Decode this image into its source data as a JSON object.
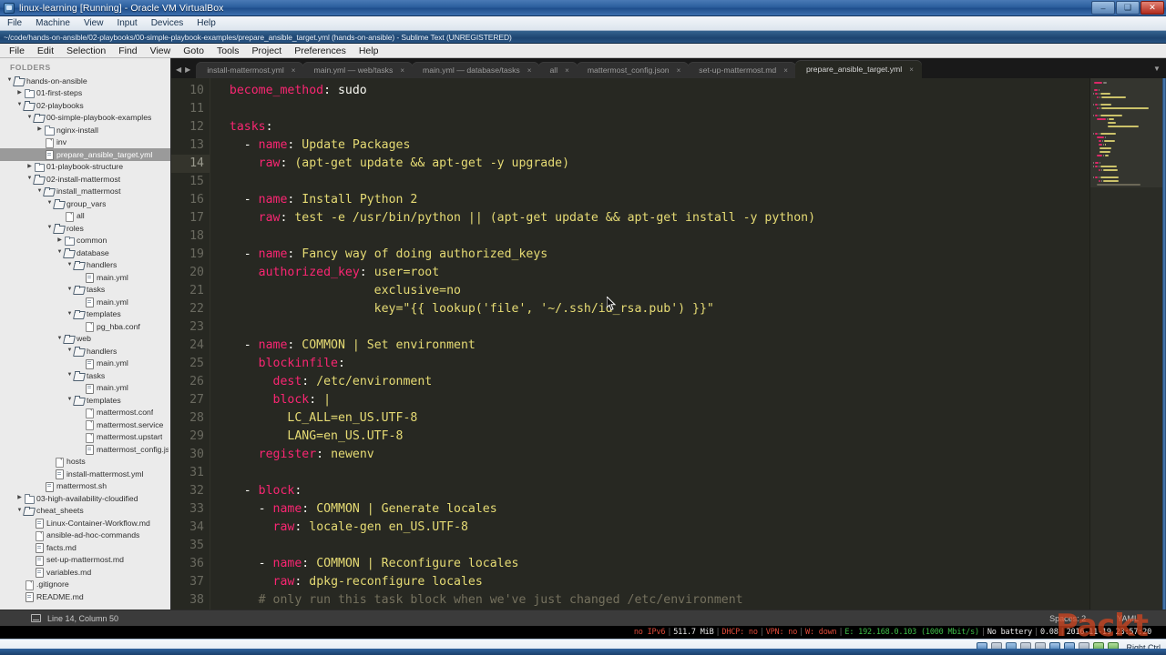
{
  "vbox": {
    "title": "linux-learning [Running] - Oracle VM VirtualBox",
    "menu": [
      "File",
      "Machine",
      "View",
      "Input",
      "Devices",
      "Help"
    ],
    "window_buttons": {
      "minimize": "–",
      "maximize": "❑",
      "close": "✕"
    },
    "host_key_label": "Right Ctrl"
  },
  "sublime": {
    "title": "~/code/hands-on-ansible/02-playbooks/00-simple-playbook-examples/prepare_ansible_target.yml (hands-on-ansible) - Sublime Text (UNREGISTERED)",
    "menu": [
      "File",
      "Edit",
      "Selection",
      "Find",
      "View",
      "Goto",
      "Tools",
      "Project",
      "Preferences",
      "Help"
    ],
    "sidebar": {
      "header": "FOLDERS",
      "items": [
        {
          "label": "hands-on-ansible",
          "depth": 0,
          "arrow": "down",
          "icon": "folder-open-icon",
          "selected": false
        },
        {
          "label": "01-first-steps",
          "depth": 1,
          "arrow": "right",
          "icon": "folder-icon",
          "selected": false
        },
        {
          "label": "02-playbooks",
          "depth": 1,
          "arrow": "down",
          "icon": "folder-open-icon",
          "selected": false
        },
        {
          "label": "00-simple-playbook-examples",
          "depth": 2,
          "arrow": "down",
          "icon": "folder-open-icon",
          "selected": false
        },
        {
          "label": "nginx-install",
          "depth": 3,
          "arrow": "right",
          "icon": "folder-icon",
          "selected": false
        },
        {
          "label": "inv",
          "depth": 3,
          "arrow": "none",
          "icon": "file-icon",
          "selected": false
        },
        {
          "label": "prepare_ansible_target.yml",
          "depth": 3,
          "arrow": "none",
          "icon": "code-file-icon",
          "selected": true
        },
        {
          "label": "01-playbook-structure",
          "depth": 2,
          "arrow": "right",
          "icon": "folder-icon",
          "selected": false
        },
        {
          "label": "02-install-mattermost",
          "depth": 2,
          "arrow": "down",
          "icon": "folder-open-icon",
          "selected": false
        },
        {
          "label": "install_mattermost",
          "depth": 3,
          "arrow": "down",
          "icon": "folder-open-icon",
          "selected": false
        },
        {
          "label": "group_vars",
          "depth": 4,
          "arrow": "down",
          "icon": "folder-open-icon",
          "selected": false
        },
        {
          "label": "all",
          "depth": 5,
          "arrow": "none",
          "icon": "file-icon",
          "selected": false
        },
        {
          "label": "roles",
          "depth": 4,
          "arrow": "down",
          "icon": "folder-open-icon",
          "selected": false
        },
        {
          "label": "common",
          "depth": 5,
          "arrow": "right",
          "icon": "folder-icon",
          "selected": false
        },
        {
          "label": "database",
          "depth": 5,
          "arrow": "down",
          "icon": "folder-open-icon",
          "selected": false
        },
        {
          "label": "handlers",
          "depth": 6,
          "arrow": "down",
          "icon": "folder-open-icon",
          "selected": false
        },
        {
          "label": "main.yml",
          "depth": 7,
          "arrow": "none",
          "icon": "code-file-icon",
          "selected": false
        },
        {
          "label": "tasks",
          "depth": 6,
          "arrow": "down",
          "icon": "folder-open-icon",
          "selected": false
        },
        {
          "label": "main.yml",
          "depth": 7,
          "arrow": "none",
          "icon": "code-file-icon",
          "selected": false
        },
        {
          "label": "templates",
          "depth": 6,
          "arrow": "down",
          "icon": "folder-open-icon",
          "selected": false
        },
        {
          "label": "pg_hba.conf",
          "depth": 7,
          "arrow": "none",
          "icon": "file-icon",
          "selected": false
        },
        {
          "label": "web",
          "depth": 5,
          "arrow": "down",
          "icon": "folder-open-icon",
          "selected": false
        },
        {
          "label": "handlers",
          "depth": 6,
          "arrow": "down",
          "icon": "folder-open-icon",
          "selected": false
        },
        {
          "label": "main.yml",
          "depth": 7,
          "arrow": "none",
          "icon": "code-file-icon",
          "selected": false
        },
        {
          "label": "tasks",
          "depth": 6,
          "arrow": "down",
          "icon": "folder-open-icon",
          "selected": false
        },
        {
          "label": "main.yml",
          "depth": 7,
          "arrow": "none",
          "icon": "code-file-icon",
          "selected": false
        },
        {
          "label": "templates",
          "depth": 6,
          "arrow": "down",
          "icon": "folder-open-icon",
          "selected": false
        },
        {
          "label": "mattermost.conf",
          "depth": 7,
          "arrow": "none",
          "icon": "file-icon",
          "selected": false
        },
        {
          "label": "mattermost.service",
          "depth": 7,
          "arrow": "none",
          "icon": "file-icon",
          "selected": false
        },
        {
          "label": "mattermost.upstart",
          "depth": 7,
          "arrow": "none",
          "icon": "file-icon",
          "selected": false
        },
        {
          "label": "mattermost_config.json",
          "depth": 7,
          "arrow": "none",
          "icon": "code-file-icon",
          "selected": false
        },
        {
          "label": "hosts",
          "depth": 4,
          "arrow": "none",
          "icon": "file-icon",
          "selected": false
        },
        {
          "label": "install-mattermost.yml",
          "depth": 4,
          "arrow": "none",
          "icon": "code-file-icon",
          "selected": false
        },
        {
          "label": "mattermost.sh",
          "depth": 3,
          "arrow": "none",
          "icon": "code-file-icon",
          "selected": false
        },
        {
          "label": "03-high-availability-cloudified",
          "depth": 1,
          "arrow": "right",
          "icon": "folder-icon",
          "selected": false
        },
        {
          "label": "cheat_sheets",
          "depth": 1,
          "arrow": "down",
          "icon": "folder-open-icon",
          "selected": false
        },
        {
          "label": "Linux-Container-Workflow.md",
          "depth": 2,
          "arrow": "none",
          "icon": "code-file-icon",
          "selected": false
        },
        {
          "label": "ansible-ad-hoc-commands",
          "depth": 2,
          "arrow": "none",
          "icon": "file-icon",
          "selected": false
        },
        {
          "label": "facts.md",
          "depth": 2,
          "arrow": "none",
          "icon": "code-file-icon",
          "selected": false
        },
        {
          "label": "set-up-mattermost.md",
          "depth": 2,
          "arrow": "none",
          "icon": "code-file-icon",
          "selected": false
        },
        {
          "label": "variables.md",
          "depth": 2,
          "arrow": "none",
          "icon": "code-file-icon",
          "selected": false
        },
        {
          "label": ".gitignore",
          "depth": 1,
          "arrow": "none",
          "icon": "file-icon",
          "selected": false
        },
        {
          "label": "README.md",
          "depth": 1,
          "arrow": "none",
          "icon": "code-file-icon",
          "selected": false
        }
      ]
    },
    "tabbar": {
      "prev_icon": "◀",
      "next_icon": "▶",
      "overflow_icon": "▼",
      "close_icon": "×",
      "tabs": [
        {
          "label": "install-mattermost.yml",
          "active": false
        },
        {
          "label": "main.yml — web/tasks",
          "active": false
        },
        {
          "label": "main.yml — database/tasks",
          "active": false
        },
        {
          "label": "all",
          "active": false
        },
        {
          "label": "mattermost_config.json",
          "active": false
        },
        {
          "label": "set-up-mattermost.md",
          "active": false
        },
        {
          "label": "prepare_ansible_target.yml",
          "active": true
        }
      ]
    },
    "editor": {
      "first_line": 10,
      "highlight_line": 14,
      "lines": [
        {
          "n": 10,
          "tokens": [
            {
              "t": "  ",
              "c": "p"
            },
            {
              "t": "become_method",
              "c": "k"
            },
            {
              "t": ": sudo",
              "c": "p"
            }
          ]
        },
        {
          "n": 11,
          "tokens": []
        },
        {
          "n": 12,
          "tokens": [
            {
              "t": "  ",
              "c": "p"
            },
            {
              "t": "tasks",
              "c": "k"
            },
            {
              "t": ":",
              "c": "p"
            }
          ]
        },
        {
          "n": 13,
          "tokens": [
            {
              "t": "    - ",
              "c": "p"
            },
            {
              "t": "name",
              "c": "k"
            },
            {
              "t": ": ",
              "c": "p"
            },
            {
              "t": "Update Packages",
              "c": "v"
            }
          ]
        },
        {
          "n": 14,
          "tokens": [
            {
              "t": "      ",
              "c": "p"
            },
            {
              "t": "raw",
              "c": "k"
            },
            {
              "t": ": ",
              "c": "p"
            },
            {
              "t": "(apt-get update && apt-get -y upgrade)",
              "c": "v"
            }
          ]
        },
        {
          "n": 15,
          "tokens": []
        },
        {
          "n": 16,
          "tokens": [
            {
              "t": "    - ",
              "c": "p"
            },
            {
              "t": "name",
              "c": "k"
            },
            {
              "t": ": ",
              "c": "p"
            },
            {
              "t": "Install Python 2",
              "c": "v"
            }
          ]
        },
        {
          "n": 17,
          "tokens": [
            {
              "t": "      ",
              "c": "p"
            },
            {
              "t": "raw",
              "c": "k"
            },
            {
              "t": ": ",
              "c": "p"
            },
            {
              "t": "test -e /usr/bin/python || (apt-get update && apt-get install -y python)",
              "c": "v"
            }
          ]
        },
        {
          "n": 18,
          "tokens": []
        },
        {
          "n": 19,
          "tokens": [
            {
              "t": "    - ",
              "c": "p"
            },
            {
              "t": "name",
              "c": "k"
            },
            {
              "t": ": ",
              "c": "p"
            },
            {
              "t": "Fancy way of doing authorized_keys",
              "c": "v"
            }
          ]
        },
        {
          "n": 20,
          "tokens": [
            {
              "t": "      ",
              "c": "p"
            },
            {
              "t": "authorized_key",
              "c": "k"
            },
            {
              "t": ": ",
              "c": "p"
            },
            {
              "t": "user=root",
              "c": "v"
            }
          ]
        },
        {
          "n": 21,
          "tokens": [
            {
              "t": "                      ",
              "c": "p"
            },
            {
              "t": "exclusive=no",
              "c": "v"
            }
          ]
        },
        {
          "n": 22,
          "tokens": [
            {
              "t": "                      ",
              "c": "p"
            },
            {
              "t": "key=\"{{ lookup('file', '~/.ssh/id_rsa.pub') }}\"",
              "c": "v"
            }
          ]
        },
        {
          "n": 23,
          "tokens": []
        },
        {
          "n": 24,
          "tokens": [
            {
              "t": "    - ",
              "c": "p"
            },
            {
              "t": "name",
              "c": "k"
            },
            {
              "t": ": ",
              "c": "p"
            },
            {
              "t": "COMMON | Set environment",
              "c": "v"
            }
          ]
        },
        {
          "n": 25,
          "tokens": [
            {
              "t": "      ",
              "c": "p"
            },
            {
              "t": "blockinfile",
              "c": "k"
            },
            {
              "t": ":",
              "c": "p"
            }
          ]
        },
        {
          "n": 26,
          "tokens": [
            {
              "t": "        ",
              "c": "p"
            },
            {
              "t": "dest",
              "c": "k"
            },
            {
              "t": ": ",
              "c": "p"
            },
            {
              "t": "/etc/environment",
              "c": "v"
            }
          ]
        },
        {
          "n": 27,
          "tokens": [
            {
              "t": "        ",
              "c": "p"
            },
            {
              "t": "block",
              "c": "k"
            },
            {
              "t": ": ",
              "c": "p"
            },
            {
              "t": "|",
              "c": "v"
            }
          ]
        },
        {
          "n": 28,
          "tokens": [
            {
              "t": "          ",
              "c": "p"
            },
            {
              "t": "LC_ALL=en_US.UTF-8",
              "c": "v"
            }
          ]
        },
        {
          "n": 29,
          "tokens": [
            {
              "t": "          ",
              "c": "p"
            },
            {
              "t": "LANG=en_US.UTF-8",
              "c": "v"
            }
          ]
        },
        {
          "n": 30,
          "tokens": [
            {
              "t": "      ",
              "c": "p"
            },
            {
              "t": "register",
              "c": "k"
            },
            {
              "t": ": ",
              "c": "p"
            },
            {
              "t": "newenv",
              "c": "v"
            }
          ]
        },
        {
          "n": 31,
          "tokens": []
        },
        {
          "n": 32,
          "tokens": [
            {
              "t": "    - ",
              "c": "p"
            },
            {
              "t": "block",
              "c": "k"
            },
            {
              "t": ":",
              "c": "p"
            }
          ]
        },
        {
          "n": 33,
          "tokens": [
            {
              "t": "      - ",
              "c": "p"
            },
            {
              "t": "name",
              "c": "k"
            },
            {
              "t": ": ",
              "c": "p"
            },
            {
              "t": "COMMON | Generate locales",
              "c": "v"
            }
          ]
        },
        {
          "n": 34,
          "tokens": [
            {
              "t": "        ",
              "c": "p"
            },
            {
              "t": "raw",
              "c": "k"
            },
            {
              "t": ": ",
              "c": "p"
            },
            {
              "t": "locale-gen en_US.UTF-8",
              "c": "v"
            }
          ]
        },
        {
          "n": 35,
          "tokens": []
        },
        {
          "n": 36,
          "tokens": [
            {
              "t": "      - ",
              "c": "p"
            },
            {
              "t": "name",
              "c": "k"
            },
            {
              "t": ": ",
              "c": "p"
            },
            {
              "t": "COMMON | Reconfigure locales",
              "c": "v"
            }
          ]
        },
        {
          "n": 37,
          "tokens": [
            {
              "t": "        ",
              "c": "p"
            },
            {
              "t": "raw",
              "c": "k"
            },
            {
              "t": ": ",
              "c": "p"
            },
            {
              "t": "dpkg-reconfigure locales",
              "c": "v"
            }
          ]
        },
        {
          "n": 38,
          "tokens": [
            {
              "t": "      ",
              "c": "p"
            },
            {
              "t": "# only run this task block when we've just changed /etc/environment",
              "c": "c"
            }
          ]
        }
      ]
    },
    "statusbar": {
      "position": "Line 14, Column 50",
      "indentation": "Spaces: 2",
      "syntax": "YAML"
    }
  },
  "vm_status_line": {
    "segments": [
      {
        "text": "no IPv6",
        "color": "red"
      },
      {
        "text": "511.7 MiB",
        "color": "white"
      },
      {
        "text": "DHCP: no",
        "color": "red"
      },
      {
        "text": "VPN: no",
        "color": "red"
      },
      {
        "text": "W: down",
        "color": "red"
      },
      {
        "text": "E: 192.168.0.103 (1000 Mbit/s)",
        "color": "green"
      },
      {
        "text": "No battery",
        "color": "white"
      },
      {
        "text": "0.08",
        "color": "white"
      },
      {
        "text": "2016-11-19 23:57:20",
        "color": "white"
      }
    ]
  },
  "minimap_columns": {
    "left": "4",
    "sel": "6",
    "c": "8",
    "d": "10"
  },
  "watermark": {
    "text": "Packt",
    "color": "#d6461f"
  },
  "theme": {
    "editor_bg": "#272822",
    "key_color": "#f92672",
    "string_color": "#e6db74",
    "comment_color": "#75715e",
    "text_color": "#f8f8f2",
    "sidebar_bg": "#ebebeb",
    "selected_row_bg": "#9a9a9a"
  }
}
